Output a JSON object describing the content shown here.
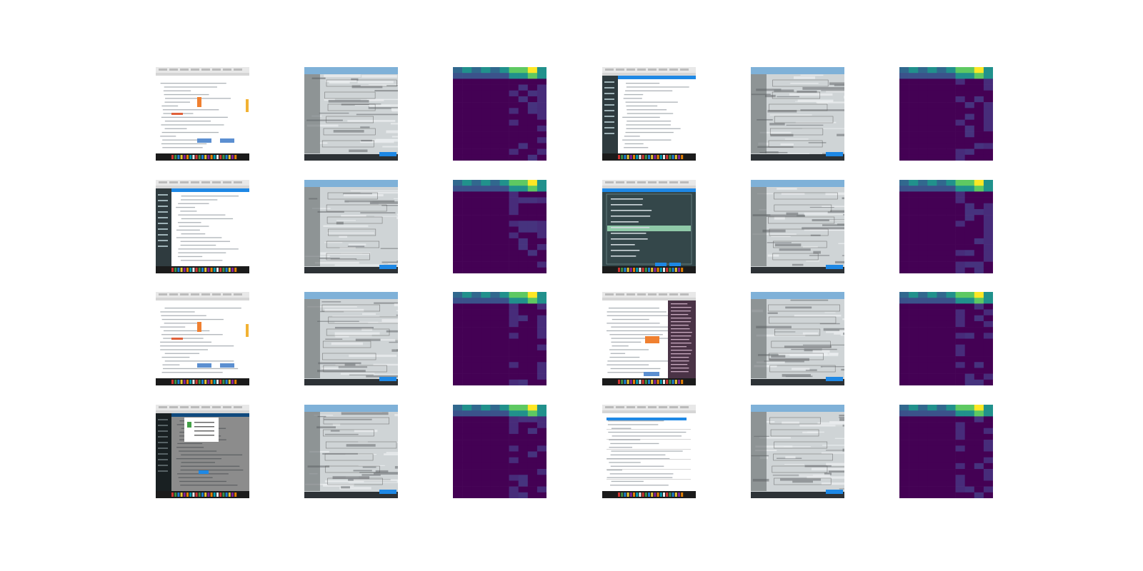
{
  "figure": {
    "rows": 4,
    "columns": 6,
    "panel_types": [
      "screenshot",
      "reconstruction",
      "heatmap"
    ],
    "rows_data": [
      {
        "left": {
          "screenshot": "light",
          "reconstruction": "gray",
          "heatmap_bright_top": true
        },
        "right": {
          "screenshot": "light-sidebar-dark",
          "reconstruction": "gray",
          "heatmap_bright_top": true
        }
      },
      {
        "left": {
          "screenshot": "sidebar-dark",
          "reconstruction": "gray",
          "heatmap_bright_top": true
        },
        "right": {
          "screenshot": "dark-teal",
          "reconstruction": "gray-blue",
          "heatmap_bright_top": true
        }
      },
      {
        "left": {
          "screenshot": "light",
          "reconstruction": "gray",
          "heatmap_bright_top": true
        },
        "right": {
          "screenshot": "light-with-dark-panel",
          "reconstruction": "gray",
          "heatmap_bright_top": true
        }
      },
      {
        "left": {
          "screenshot": "dark-modal",
          "reconstruction": "gray",
          "heatmap_bright_top": true
        },
        "right": {
          "screenshot": "light-table",
          "reconstruction": "gray",
          "heatmap_bright_top": true
        }
      }
    ]
  },
  "colors": {
    "heatmap_dark": "#440154",
    "heatmap_mid": "#31688e",
    "heatmap_teal": "#21918c",
    "heatmap_green": "#5ec962",
    "heatmap_yellow": "#fde725",
    "taskbar": "#1b1b1b",
    "accent_blue": "#1e88e5",
    "sidebar_dark": "#2f3b3f",
    "highlight_green": "#8fc9a8",
    "orange": "#f08030"
  }
}
